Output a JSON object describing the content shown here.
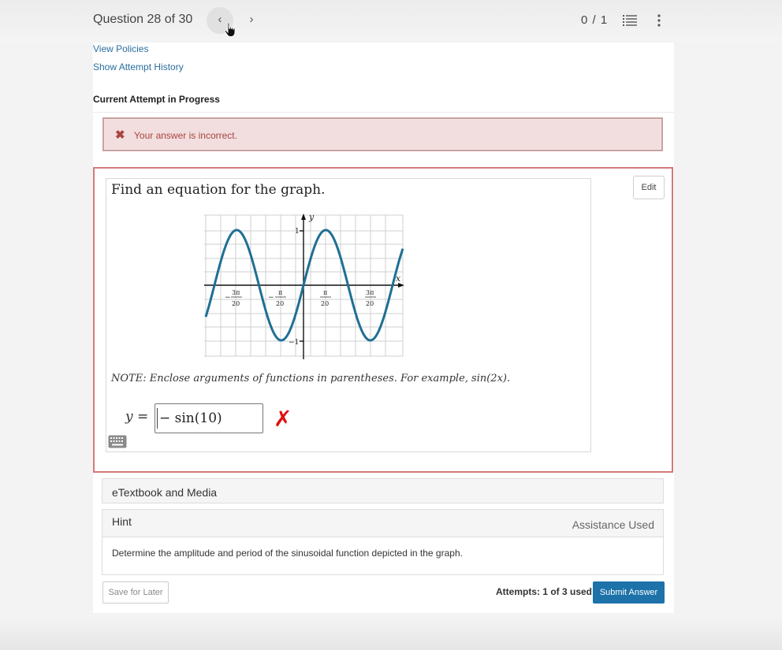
{
  "header": {
    "question_counter": "Question 28 of 30",
    "prev_label": "‹",
    "next_label": "›",
    "score": "0 / 1"
  },
  "links": {
    "view_policies": "View Policies",
    "show_history": "Show Attempt History"
  },
  "attempt_status": "Current Attempt in Progress",
  "feedback": {
    "icon": "✖",
    "message": "Your answer is incorrect."
  },
  "question": {
    "prompt": "Find an equation for the graph.",
    "edit_label": "Edit",
    "graph": {
      "x_axis_label": "x",
      "y_axis_label": "y",
      "y_tick_top": "1",
      "y_tick_bottom": "−1",
      "x_ticks": [
        {
          "num": "3π",
          "den": "20",
          "neg": "−"
        },
        {
          "num": "π",
          "den": "20",
          "neg": "−"
        },
        {
          "num": "π",
          "den": "20",
          "neg": ""
        },
        {
          "num": "3π",
          "den": "20",
          "neg": ""
        }
      ],
      "curve_color": "#1f6f94"
    },
    "note": "NOTE: Enclose arguments of functions in parentheses. For example, sin(2x).",
    "answer_prefix": "y =",
    "answer_value": "− sin(10)",
    "result_mark": "✗"
  },
  "panels": {
    "etextbook": "eTextbook and Media",
    "hint": "Hint",
    "hint_status": "Assistance Used",
    "hint_text": "Determine the amplitude and period of the sinusoidal function depicted in the graph."
  },
  "footer": {
    "save_label": "Save for Later",
    "attempts": "Attempts: 1 of 3 used",
    "submit_label": "Submit Answer"
  },
  "colors": {
    "accent": "#1d72aa",
    "error_bg": "#f2dede",
    "error_text": "#a94442",
    "wrong_mark": "#dd1111"
  }
}
